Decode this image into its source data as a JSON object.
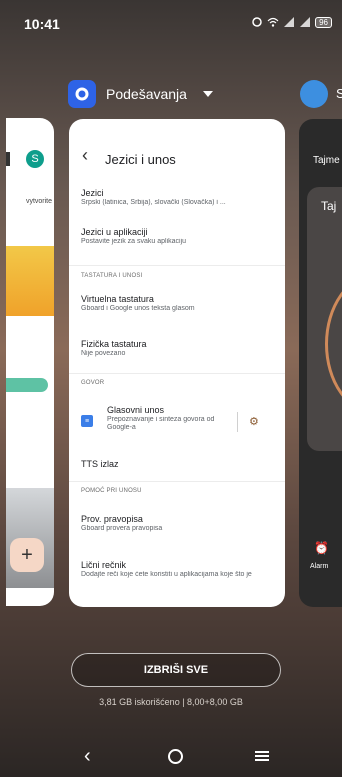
{
  "status": {
    "time": "10:41",
    "battery": "96",
    "icons": [
      "alarm-icon",
      "wifi-icon",
      "signal-icon",
      "signal-icon"
    ]
  },
  "app": {
    "name": "Podešavanja",
    "right_app_letter": "S"
  },
  "left_card": {
    "avatar_letter": "S",
    "text": "vytvorite"
  },
  "settings": {
    "title": "Jezici i unos",
    "items": [
      {
        "title": "Jezici",
        "subtitle": "Srpski (latinica, Srbija), slovački (Slovačka) i ..."
      },
      {
        "title": "Jezici u aplikaciji",
        "subtitle": "Postavite jezik za svaku aplikaciju"
      }
    ],
    "section_keyboard": "TASTATURA I UNOSI",
    "keyboard_items": [
      {
        "title": "Virtuelna tastatura",
        "subtitle": "Gboard i Google unos teksta glasom"
      },
      {
        "title": "Fizička tastatura",
        "subtitle": "Nije povezano"
      }
    ],
    "section_voice": "GOVOR",
    "voice_item": {
      "title": "Glasovni unos",
      "subtitle1": "Prepoznavanje i sinteza govora od",
      "subtitle2": "Google-a"
    },
    "tts": "TTS izlaz",
    "section_help": "POMOĆ PRI UNOSU",
    "help_items": [
      {
        "title": "Prov. pravopisa",
        "subtitle": "Gboard provera pravopisa"
      },
      {
        "title": "Lični rečnik",
        "subtitle": "Dodajte reči koje ćete koristiti u aplikacijama koje što je"
      }
    ]
  },
  "right_card": {
    "top": "Tajme",
    "inner": "Taj",
    "alarm": "Alarm"
  },
  "bottom": {
    "clear_all": "IZBRIŠI SVE",
    "memory": "3,81 GB iskorišćeno | 8,00+8,00 GB"
  }
}
